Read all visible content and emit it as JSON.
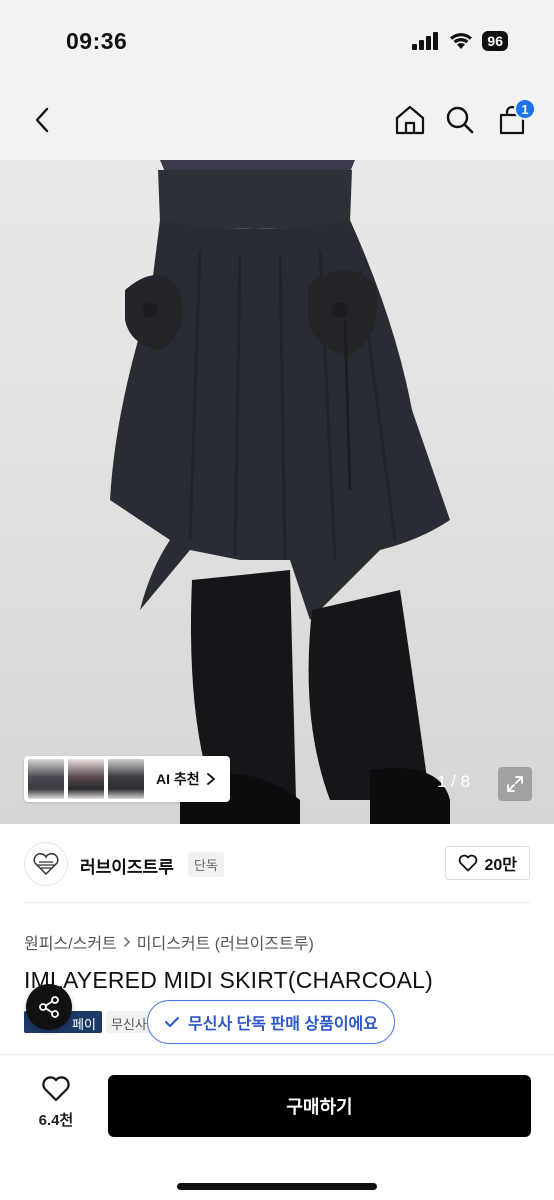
{
  "status_bar": {
    "time": "09:36",
    "battery": "96",
    "icons": [
      "signal-icon",
      "wifi-icon",
      "battery-icon"
    ]
  },
  "nav": {
    "icons": [
      "back-icon",
      "home-icon",
      "search-icon",
      "cart-icon"
    ],
    "cart_count": "1"
  },
  "gallery": {
    "ai_label": "AI 추천",
    "counter": "1 / 8",
    "thumbnail_count": 3
  },
  "brand": {
    "name": "러브이즈트루",
    "tag": "단독",
    "like_count": "20만"
  },
  "breadcrumb": {
    "category": "원피스/스커트",
    "subcategory": "미디스커트 (러브이즈트루)"
  },
  "product": {
    "title": "IMLAYERED MIDI SKIRT(CHARCOAL)",
    "pay_badge": "페이",
    "musinsa_tag": "무신사"
  },
  "toast": {
    "text": "무신사 단독 판매 상품이에요"
  },
  "bottom": {
    "wish_count": "6.4천",
    "buy_label": "구매하기"
  },
  "colors": {
    "accent": "#1a73e8",
    "toast_border": "#4a76e8",
    "toast_text": "#2a56c6",
    "pay_badge": "#1b3a66",
    "buy_button": "#000000"
  }
}
